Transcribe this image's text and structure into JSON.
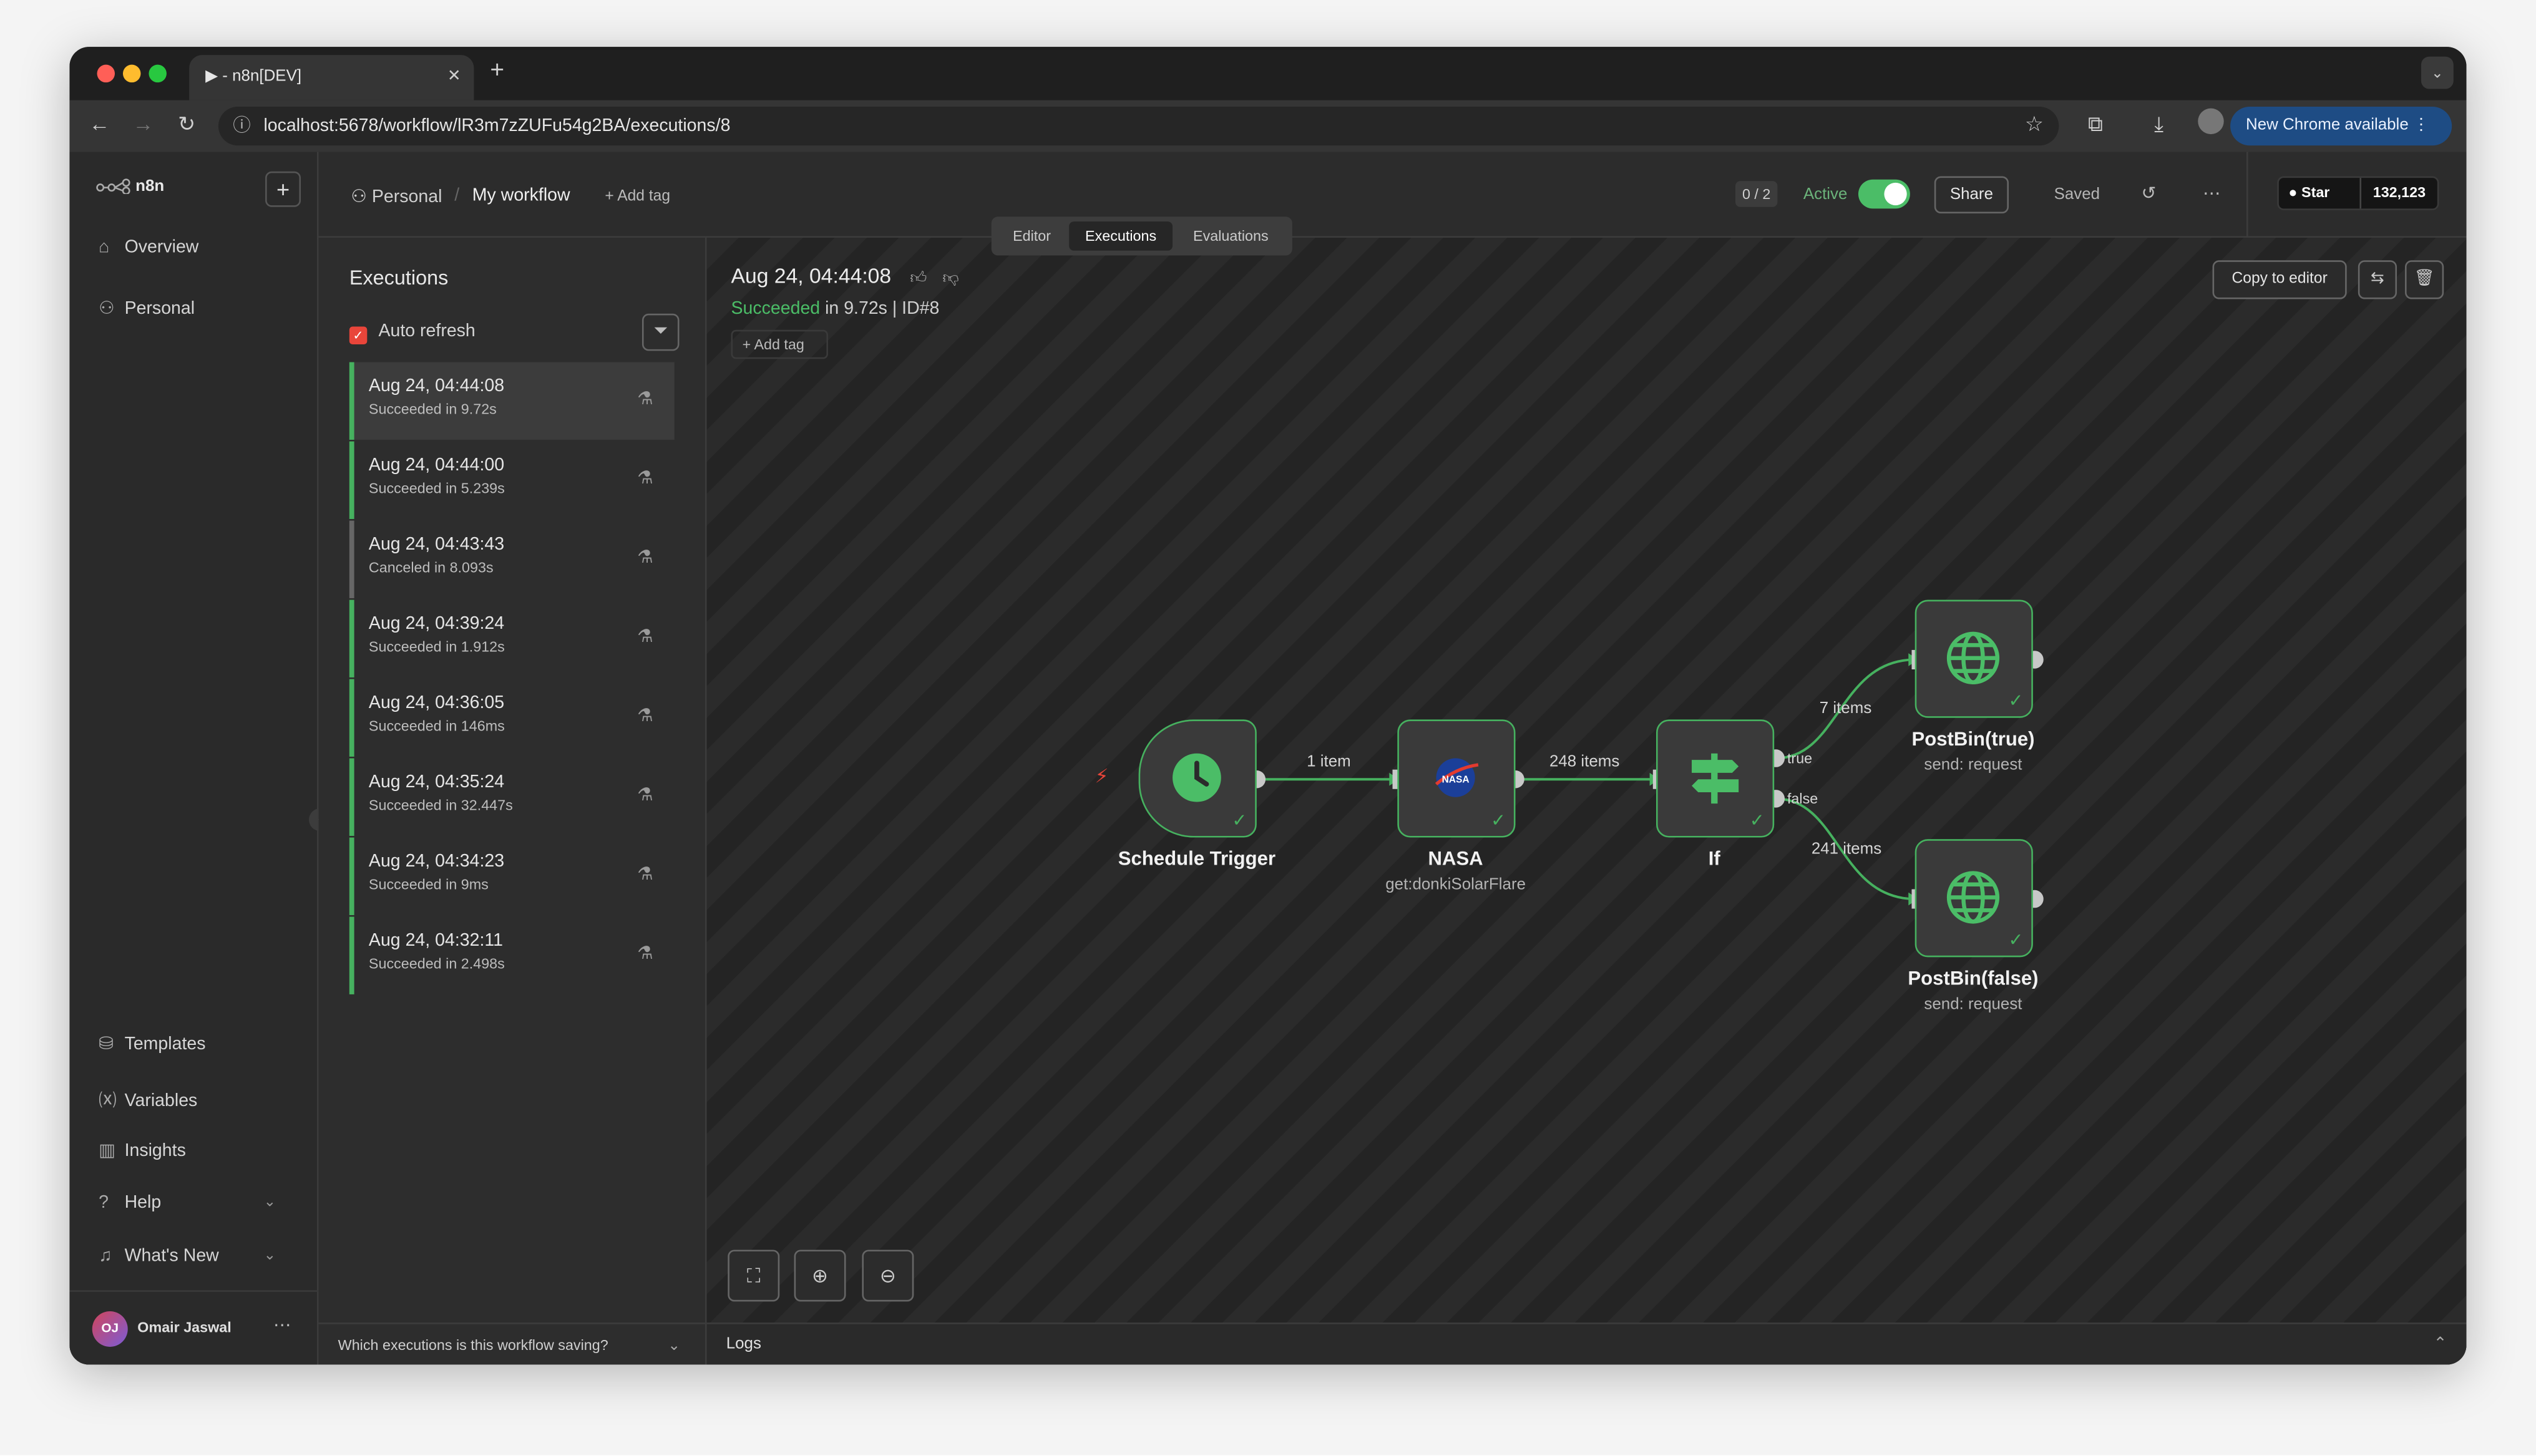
{
  "browser": {
    "tab_title": "▶ - n8n[DEV]",
    "tab_close": "✕",
    "new_tab": "+",
    "url": "localhost:5678/workflow/lR3m7zZUFu54g2BA/executions/8",
    "chrome_update": "New Chrome available"
  },
  "sidebar": {
    "brand": "n8n",
    "add_button": "+",
    "nav": [
      {
        "label": "Overview",
        "icon": "home-icon"
      },
      {
        "label": "Personal",
        "icon": "user-icon"
      }
    ],
    "bottom_nav": [
      {
        "label": "Templates",
        "icon": "templates-icon"
      },
      {
        "label": "Variables",
        "icon": "variables-icon"
      },
      {
        "label": "Insights",
        "icon": "insights-icon"
      },
      {
        "label": "Help",
        "icon": "help-icon"
      },
      {
        "label": "What's New",
        "icon": "bell-icon"
      }
    ],
    "user": {
      "initials": "OJ",
      "name": "Omair Jaswal"
    }
  },
  "header": {
    "project": "Personal",
    "workflow": "My workflow",
    "add_tag": "+ Add tag",
    "counter": "0 / 2",
    "active_label": "Active",
    "active": true,
    "share": "Share",
    "saved": "Saved",
    "github_star": "Star",
    "github_count": "132,123",
    "tabs": [
      "Editor",
      "Executions",
      "Evaluations"
    ],
    "selected_tab": "Executions"
  },
  "executions": {
    "title": "Executions",
    "auto_refresh": "Auto refresh",
    "auto_refresh_checked": true,
    "items": [
      {
        "time": "Aug 24, 04:44:08",
        "status": "Succeeded in 9.72s",
        "selected": true
      },
      {
        "time": "Aug 24, 04:44:00",
        "status": "Succeeded in 5.239s"
      },
      {
        "time": "Aug 24, 04:43:43",
        "status": "Canceled in 8.093s"
      },
      {
        "time": "Aug 24, 04:39:24",
        "status": "Succeeded in 1.912s"
      },
      {
        "time": "Aug 24, 04:36:05",
        "status": "Succeeded in 146ms"
      },
      {
        "time": "Aug 24, 04:35:24",
        "status": "Succeeded in 32.447s"
      },
      {
        "time": "Aug 24, 04:34:23",
        "status": "Succeeded in 9ms"
      },
      {
        "time": "Aug 24, 04:32:11",
        "status": "Succeeded in 2.498s"
      }
    ],
    "footer": "Which executions is this workflow saving?"
  },
  "detail": {
    "title": "Aug 24, 04:44:08",
    "status_word": "Succeeded",
    "status_rest": " in 9.72s | ID#8",
    "add_tag": "+ Add tag",
    "copy_to_editor": "Copy to editor"
  },
  "workflow": {
    "nodes": [
      {
        "name": "Schedule Trigger",
        "subtitle": "",
        "icon": "clock-icon"
      },
      {
        "name": "NASA",
        "subtitle": "get:donkiSolarFlare",
        "icon": "nasa-logo-icon"
      },
      {
        "name": "If",
        "subtitle": "",
        "icon": "signpost-icon"
      },
      {
        "name": "PostBin(true)",
        "subtitle": "send: request",
        "icon": "globe-icon"
      },
      {
        "name": "PostBin(false)",
        "subtitle": "send: request",
        "icon": "globe-icon"
      }
    ],
    "edge_labels": {
      "trigger_to_nasa": "1 item",
      "nasa_to_if": "248 items",
      "if_true": "7 items",
      "if_false": "241 items"
    },
    "branch_labels": {
      "true": "true",
      "false": "false"
    }
  },
  "logs": {
    "label": "Logs"
  },
  "colors": {
    "success": "#4bbd67",
    "accent": "#e9453a",
    "chrome_button": "#1e4c84"
  }
}
